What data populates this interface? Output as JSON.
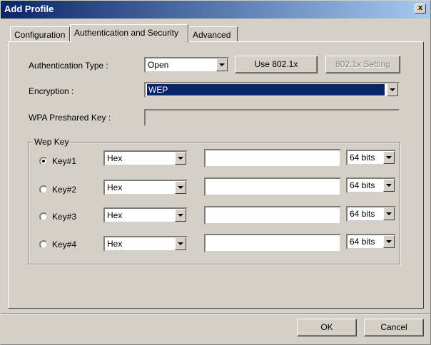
{
  "window": {
    "title": "Add Profile",
    "close_label": "x"
  },
  "tabs": [
    {
      "label": "Configuration"
    },
    {
      "label": "Authentication and Security"
    },
    {
      "label": "Advanced"
    }
  ],
  "auth": {
    "type_label": "Authentication Type :",
    "type_value": "Open",
    "use8021x_label": "Use 802.1x",
    "setting8021x_label": "802.1x Setting"
  },
  "encryption": {
    "label": "Encryption :",
    "value": "WEP"
  },
  "wpa": {
    "label": "WPA Preshared Key :",
    "value": ""
  },
  "wep": {
    "group_label": "Wep Key",
    "keys": [
      {
        "label": "Key#1",
        "format": "Hex",
        "value": "",
        "bits": "64 bits",
        "selected": true
      },
      {
        "label": "Key#2",
        "format": "Hex",
        "value": "",
        "bits": "64 bits",
        "selected": false
      },
      {
        "label": "Key#3",
        "format": "Hex",
        "value": "",
        "bits": "64 bits",
        "selected": false
      },
      {
        "label": "Key#4",
        "format": "Hex",
        "value": "",
        "bits": "64 bits",
        "selected": false
      }
    ]
  },
  "footer": {
    "ok_label": "OK",
    "cancel_label": "Cancel"
  }
}
